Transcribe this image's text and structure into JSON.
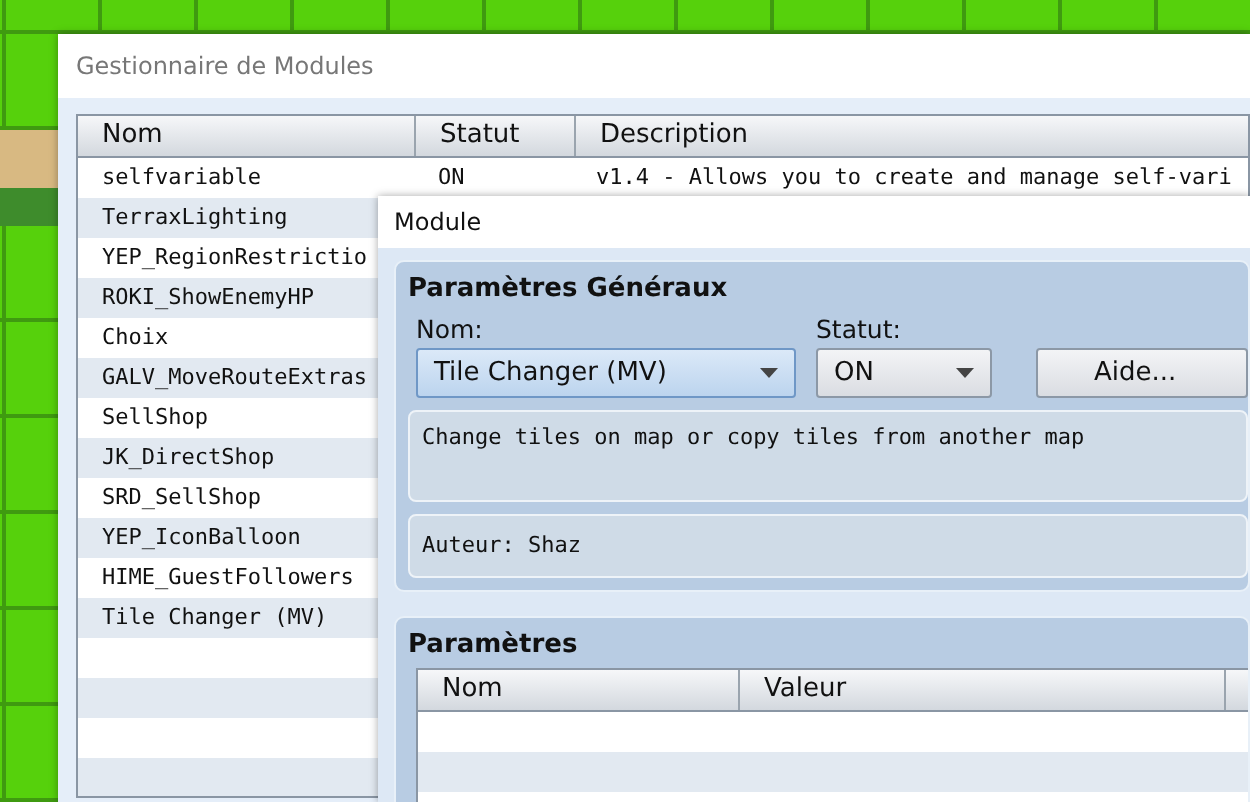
{
  "main_window": {
    "title": "Gestionnaire de Modules",
    "table": {
      "columns": [
        "Nom",
        "Statut",
        "Description"
      ],
      "rows": [
        {
          "name": "selfvariable",
          "status": "ON",
          "description": "v1.4 - Allows you to create and manage self-vari"
        },
        {
          "name": "TerraxLighting"
        },
        {
          "name": "YEP_RegionRestrictio"
        },
        {
          "name": "ROKI_ShowEnemyHP"
        },
        {
          "name": "Choix"
        },
        {
          "name": "GALV_MoveRouteExtras"
        },
        {
          "name": "SellShop"
        },
        {
          "name": "JK_DirectShop"
        },
        {
          "name": "SRD_SellShop"
        },
        {
          "name": "YEP_IconBalloon"
        },
        {
          "name": "HIME_GuestFollowers"
        },
        {
          "name": "Tile Changer (MV)"
        }
      ]
    }
  },
  "dialog": {
    "title": "Module",
    "general": {
      "title": "Paramètres Généraux",
      "name_label": "Nom:",
      "name_value": "Tile Changer (MV)",
      "status_label": "Statut:",
      "status_value": "ON",
      "help_button": "Aide...",
      "description": "Change tiles on map or copy tiles from another map",
      "author": "Auteur: Shaz"
    },
    "parameters": {
      "title": "Paramètres",
      "columns": [
        "Nom",
        "Valeur"
      ]
    }
  }
}
